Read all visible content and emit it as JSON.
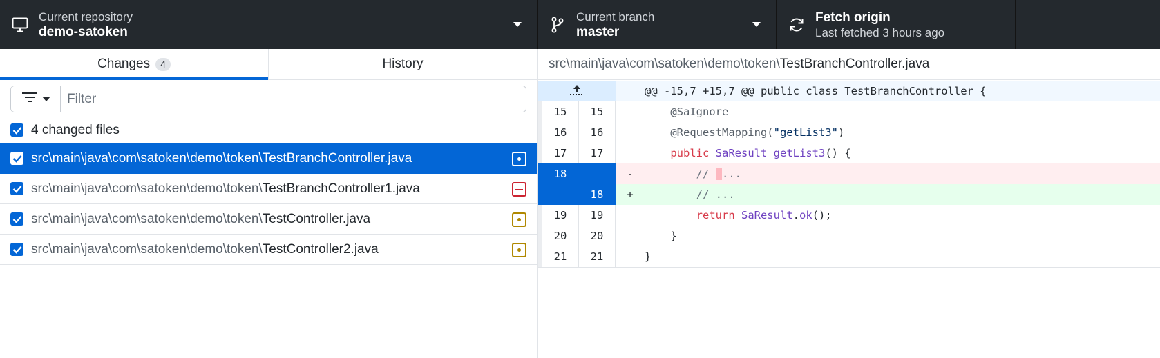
{
  "toolbar": {
    "repository": {
      "label": "Current repository",
      "value": "demo-satoken",
      "icon": "desktop-icon"
    },
    "branch": {
      "label": "Current branch",
      "value": "master",
      "icon": "git-branch-icon"
    },
    "fetch": {
      "title": "Fetch origin",
      "subtitle": "Last fetched 3 hours ago",
      "icon": "sync-icon"
    }
  },
  "tabs": {
    "changes_label": "Changes",
    "changes_count": "4",
    "history_label": "History"
  },
  "filter": {
    "placeholder": "Filter",
    "value": ""
  },
  "changed_files_label": "4 changed files",
  "files": [
    {
      "dir": "src\\main\\java\\com\\satoken\\demo\\token\\",
      "name": "TestBranchController.java",
      "status": "modified",
      "selected": true
    },
    {
      "dir": "src\\main\\java\\com\\satoken\\demo\\token\\",
      "name": "TestBranchController1.java",
      "status": "deleted",
      "selected": false
    },
    {
      "dir": "src\\main\\java\\com\\satoken\\demo\\token\\",
      "name": "TestController.java",
      "status": "modified",
      "selected": false
    },
    {
      "dir": "src\\main\\java\\com\\satoken\\demo\\token\\",
      "name": "TestController2.java",
      "status": "modified",
      "selected": false
    }
  ],
  "diff": {
    "path_dir": "src\\main\\java\\com\\satoken\\demo\\token\\",
    "path_name": "TestBranchController.java",
    "hunk_header": "@@ -15,7 +15,7 @@ public class TestBranchController {",
    "lines": [
      {
        "old": "15",
        "new": "15",
        "marker": "",
        "indent": "    ",
        "parts": [
          [
            "ann",
            "@SaIgnore"
          ]
        ]
      },
      {
        "old": "16",
        "new": "16",
        "marker": "",
        "indent": "    ",
        "parts": [
          [
            "ann",
            "@RequestMapping("
          ],
          [
            "str",
            "\"getList3\""
          ],
          [
            "plain",
            ")"
          ]
        ]
      },
      {
        "old": "17",
        "new": "17",
        "marker": "",
        "indent": "    ",
        "parts": [
          [
            "kw",
            "public "
          ],
          [
            "type",
            "SaResult "
          ],
          [
            "type",
            "getList3"
          ],
          [
            "plain",
            "() {"
          ]
        ]
      },
      {
        "old": "18",
        "new": "",
        "marker": "-",
        "indent": "        ",
        "parts": [
          [
            "cm",
            "// "
          ],
          [
            "hl",
            " "
          ],
          [
            "cm",
            "..."
          ]
        ]
      },
      {
        "old": "",
        "new": "18",
        "marker": "+",
        "indent": "        ",
        "parts": [
          [
            "cm",
            "// ..."
          ]
        ]
      },
      {
        "old": "19",
        "new": "19",
        "marker": "",
        "indent": "        ",
        "parts": [
          [
            "kw",
            "return "
          ],
          [
            "type",
            "SaResult"
          ],
          [
            "plain",
            "."
          ],
          [
            "type",
            "ok"
          ],
          [
            "plain",
            "();"
          ]
        ]
      },
      {
        "old": "20",
        "new": "20",
        "marker": "",
        "indent": "    ",
        "parts": [
          [
            "plain",
            "}"
          ]
        ]
      },
      {
        "old": "21",
        "new": "21",
        "marker": "",
        "indent": "",
        "parts": [
          [
            "plain",
            "}"
          ]
        ]
      }
    ]
  },
  "colors": {
    "toolbar_bg": "#24292e",
    "accent": "#0366d6",
    "status_modified": "#b08800",
    "status_deleted": "#cb2431",
    "diff_deleted_bg": "#ffeef0",
    "diff_added_bg": "#e6ffed"
  }
}
